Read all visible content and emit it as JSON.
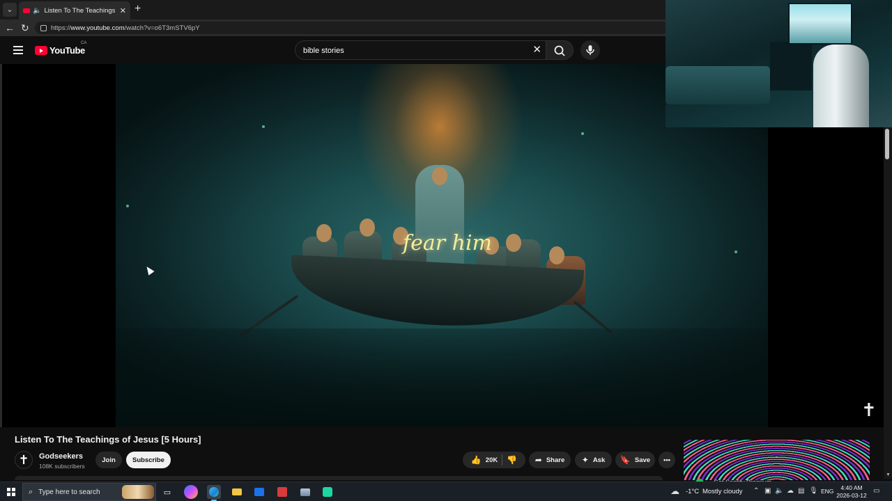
{
  "browser": {
    "tab_title": "Listen To The Teachings of Jesus",
    "tab_close": "✕",
    "new_tab": "+",
    "url_prefix": "https://",
    "url_domain": "www.youtube.com",
    "url_path": "/watch?v=o6T3mSTV6pY"
  },
  "youtube": {
    "logo_text": "YouTube",
    "country_code": "CA",
    "search_query": "bible stories"
  },
  "player": {
    "caption_text": "fear him",
    "watermark_glyph": "✝"
  },
  "video": {
    "title": "Listen To The Teachings of Jesus [5 Hours]",
    "channel_avatar_glyph": "✝",
    "channel_name": "Godseekers",
    "subscribers": "108K subscribers",
    "join_label": "Join",
    "subscribe_label": "Subscribe",
    "like_count": "20K",
    "share_label": "Share",
    "ask_label": "Ask",
    "save_label": "Save",
    "more_label": "•••"
  },
  "promo": {
    "text": "Get Spotify Premium"
  },
  "taskbar": {
    "search_placeholder": "Type here to search",
    "weather_temp": "-1°C",
    "weather_desc": "Mostly cloudy",
    "language": "ENG",
    "time": "4:40 AM",
    "date": "2026-03-12"
  },
  "colors": {
    "youtube_red": "#ff0033",
    "background": "#0f0f0f",
    "subscribe_bg": "#f1f1f1",
    "caption_yellow": "#f4ef9a"
  }
}
